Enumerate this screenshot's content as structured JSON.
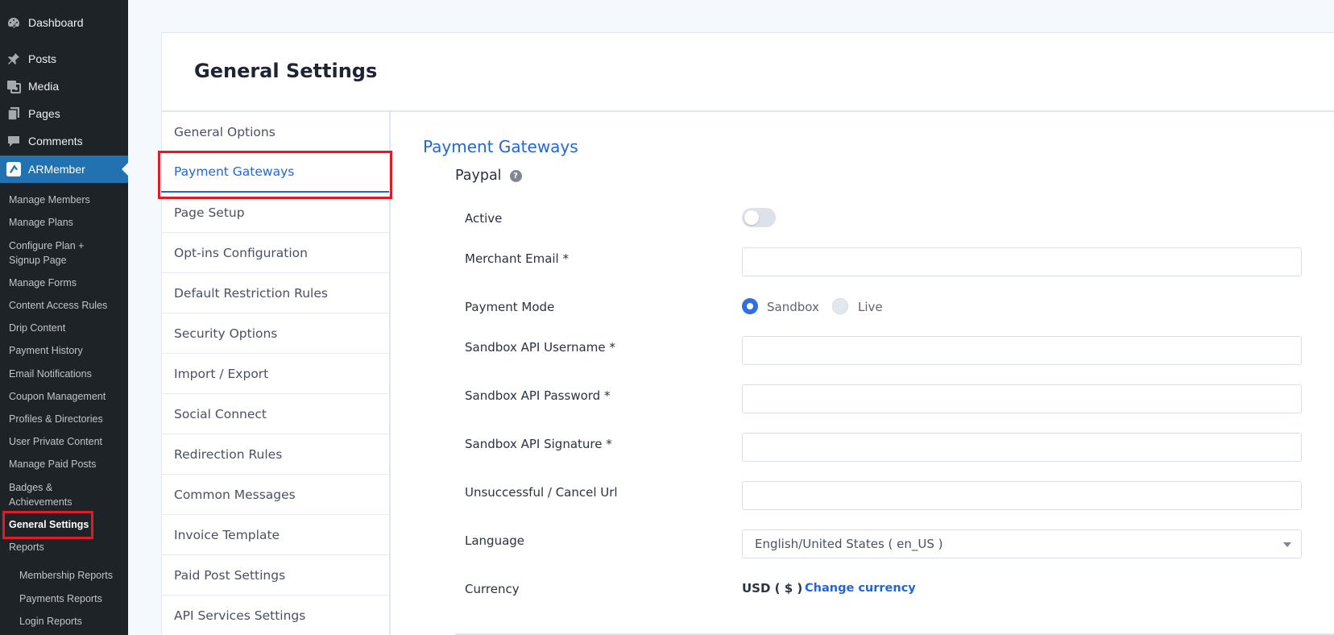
{
  "sidebar": {
    "top_items": [
      {
        "label": "Dashboard",
        "icon": "dashboard-icon"
      },
      {
        "label": "Posts",
        "icon": "pin-icon"
      },
      {
        "label": "Media",
        "icon": "media-icon"
      },
      {
        "label": "Pages",
        "icon": "pages-icon"
      },
      {
        "label": "Comments",
        "icon": "comment-icon"
      },
      {
        "label": "ARMember",
        "icon": "armember-icon"
      }
    ],
    "sub_items": [
      "Manage Members",
      "Manage Plans",
      "Configure Plan +\nSignup Page",
      "Manage Forms",
      "Content Access Rules",
      "Drip Content",
      "Payment History",
      "Email Notifications",
      "Coupon Management",
      "Profiles & Directories",
      "User Private Content",
      "Manage Paid Posts",
      "Badges &\nAchievements",
      "General Settings",
      "Reports",
      "Membership Reports",
      "Payments Reports",
      "Login Reports"
    ]
  },
  "page": {
    "title": "General Settings"
  },
  "tabs": [
    "General Options",
    "Payment Gateways",
    "Page Setup",
    "Opt-ins Configuration",
    "Default Restriction Rules",
    "Security Options",
    "Import / Export",
    "Social Connect",
    "Redirection Rules",
    "Common Messages",
    "Invoice Template",
    "Paid Post Settings",
    "API Services Settings"
  ],
  "content": {
    "section_title": "Payment Gateways",
    "gateway_name": "Paypal",
    "help_glyph": "?",
    "fields": {
      "active_label": "Active",
      "active_state": "off",
      "merchant_email_label": "Merchant Email *",
      "payment_mode_label": "Payment Mode",
      "mode_sandbox": "Sandbox",
      "mode_live": "Live",
      "mode_selected": "Sandbox",
      "api_username_label": "Sandbox API Username *",
      "api_password_label": "Sandbox API Password *",
      "api_signature_label": "Sandbox API Signature *",
      "cancel_url_label": "Unsuccessful / Cancel Url",
      "language_label": "Language",
      "language_value": "English/United States ( en_US )",
      "currency_label": "Currency",
      "currency_value": "USD ( $ )",
      "change_currency": "Change currency"
    }
  },
  "colors": {
    "accent": "#2266d6",
    "sidebar_bg": "#1d2327",
    "sidebar_active": "#2271b1",
    "highlight": "#e01b24"
  }
}
